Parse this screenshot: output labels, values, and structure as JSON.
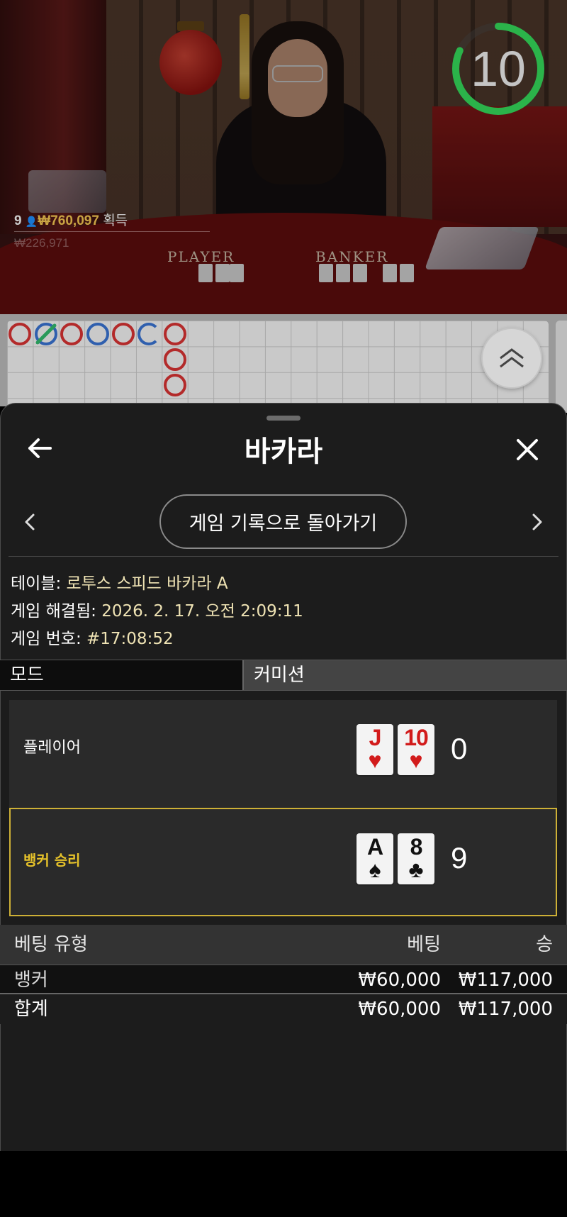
{
  "live": {
    "timer": "10",
    "winner": {
      "rank": "9",
      "amount": "₩760,097",
      "label": "획득",
      "faded": "₩226,971"
    },
    "table_labels": {
      "player": "PLAYER",
      "banker": "BANKER"
    }
  },
  "sheet": {
    "title": "바카라",
    "back_history_label": "게임 기록으로 돌아가기",
    "info": {
      "table_key": "테이블:",
      "table_value": "로투스 스피드 바카라 A",
      "resolved_key": "게임 해결됨:",
      "resolved_value": "2026. 2. 17. 오전 2:09:11",
      "number_key": "게임 번호:",
      "number_value": "#17:08:52"
    },
    "mode_label": "모드",
    "commission_label": "커미션",
    "hands": {
      "player": {
        "label": "플레이어",
        "cards": [
          {
            "rank": "J",
            "suit": "♥"
          },
          {
            "rank": "10",
            "suit": "♥"
          }
        ],
        "score": "0"
      },
      "banker": {
        "label": "뱅커 승리",
        "cards": [
          {
            "rank": "A",
            "suit": "♠"
          },
          {
            "rank": "8",
            "suit": "♣"
          }
        ],
        "score": "9"
      }
    },
    "bets": {
      "headers": {
        "type": "베팅 유형",
        "bet": "베팅",
        "win": "승"
      },
      "rows": [
        {
          "type": "뱅커",
          "bet": "₩60,000",
          "win": "₩117,000"
        }
      ],
      "total": {
        "type": "합계",
        "bet": "₩60,000",
        "win": "₩117,000"
      }
    }
  },
  "colors": {
    "accent_gold": "#cdb036",
    "win_label": "#e6c22a",
    "info_value": "#efe3b4",
    "timer_ring": "#2bb34a",
    "banker_ring": "#b32a2a",
    "player_ring": "#2f5fae",
    "tie_mark": "#2a9a5a"
  },
  "icons": {
    "back": "arrow-left-icon",
    "close": "close-x-icon",
    "prev": "chevron-left-icon",
    "next": "chevron-right-icon",
    "scroll_up": "double-chevron-up-icon",
    "user": "user-icon"
  }
}
